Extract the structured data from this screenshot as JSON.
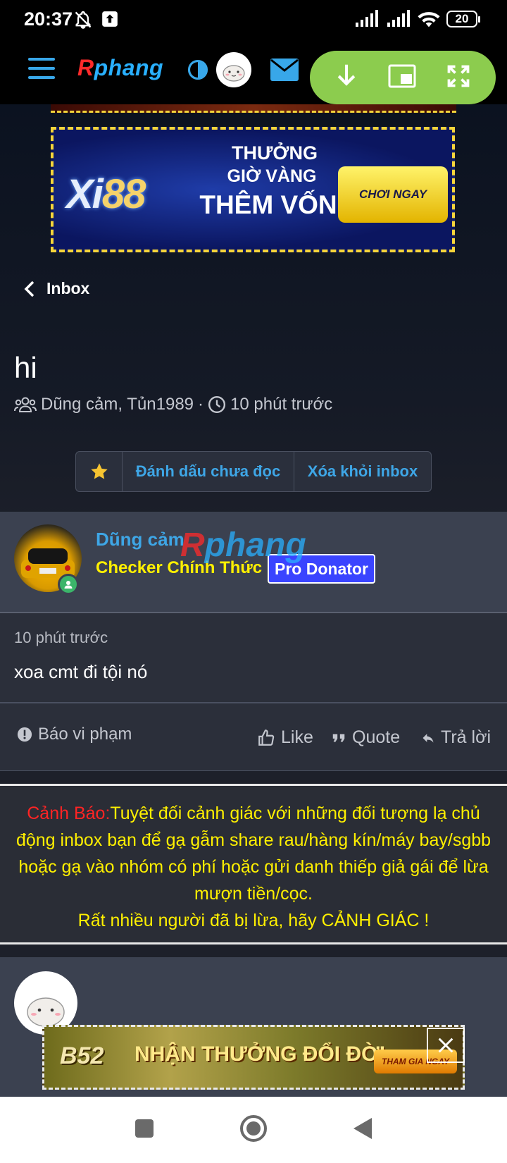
{
  "status_bar": {
    "time": "20:37",
    "battery": "20",
    "icons": [
      "bell-off-icon",
      "upload-icon",
      "signal-icon",
      "signal-icon",
      "wifi-icon",
      "battery-icon"
    ]
  },
  "header": {
    "logo_r": "R",
    "logo_rest": "phang",
    "icons": [
      "menu-icon",
      "contrast-icon",
      "avatar",
      "mail-icon"
    ],
    "pip_controls": [
      "download-icon",
      "picture-in-picture-icon",
      "fullscreen-icon"
    ],
    "accent_color": "#38a7e9",
    "pip_color": "#8ccc4e"
  },
  "ad_top": {
    "logo_a": "Xi",
    "logo_b": "88",
    "line1": "THƯỞNG",
    "line2": "GIỜ VÀNG",
    "line3": "THÊM VỐN",
    "cta": "CHƠI NGAY"
  },
  "nav": {
    "back_label": "Inbox"
  },
  "thread": {
    "title": "hi",
    "participants": "Dũng cảm, Tủn1989",
    "separator": "·",
    "time": "10 phút trước"
  },
  "actions": {
    "mark_unread": "Đánh dấu chưa đọc",
    "remove_inbox": "Xóa khỏi inbox"
  },
  "message": {
    "author": "Dũng cảm",
    "user_title": "Checker Chính Thức",
    "badge": "Pro Donator",
    "watermark_r": "R",
    "watermark_rest": "phang",
    "time": "10 phút trước",
    "text": "xoa cmt đi tội nó",
    "report": "Báo vi phạm",
    "like": "Like",
    "quote": "Quote",
    "reply": "Trả lời"
  },
  "warning": {
    "label": "Cảnh Báo:",
    "text": "Tuyệt đối cảnh giác với những đối tượng lạ chủ động inbox bạn để gạ gẫm share rau/hàng kín/máy bay/sgbb hoặc gạ vào nhóm có phí hoặc gửi danh thiếp giả gái để lừa mượn tiền/cọc.",
    "text2": "Rất nhiều người đã bị lừa, hãy CẢNH GIÁC !",
    "label_color": "#ff2424",
    "text_color": "#fff000"
  },
  "ad_bottom": {
    "logo": "B52",
    "slogan": "NHẬN THƯỞNG ĐỔI ĐỜI",
    "cta": "THAM GIA NGAY"
  },
  "navigation_bar": [
    "recent-apps-icon",
    "home-icon",
    "back-icon"
  ]
}
